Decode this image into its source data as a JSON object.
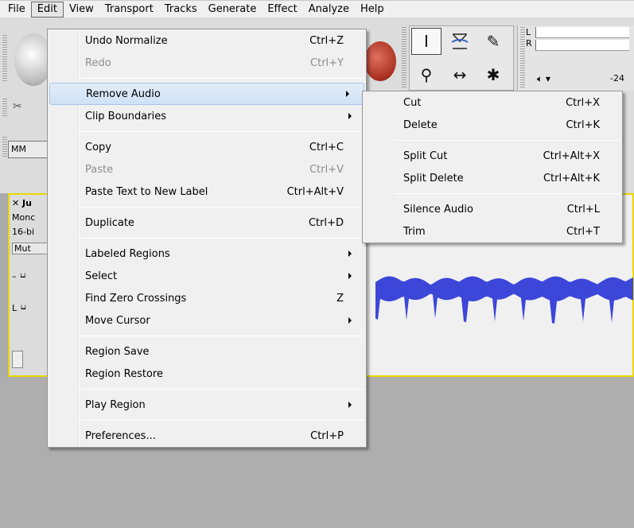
{
  "menubar": [
    "File",
    "Edit",
    "View",
    "Transport",
    "Tracks",
    "Generate",
    "Effect",
    "Analyze",
    "Help"
  ],
  "background": {
    "mm_label": "MM",
    "track_close": "✕ Ju",
    "track_channel": "Monc",
    "track_format": "16-bi",
    "track_mute": "Mut",
    "meter_l": "L",
    "meter_r": "R",
    "meter_db": "-24"
  },
  "edit_menu": {
    "groups": [
      [
        {
          "label": "Undo Normalize",
          "shortcut": "Ctrl+Z"
        },
        {
          "label": "Redo",
          "shortcut": "Ctrl+Y",
          "disabled": true
        }
      ],
      [
        {
          "label": "Remove Audio",
          "submenu": true,
          "highlighted": true
        },
        {
          "label": "Clip Boundaries",
          "submenu": true
        }
      ],
      [
        {
          "label": "Copy",
          "shortcut": "Ctrl+C"
        },
        {
          "label": "Paste",
          "shortcut": "Ctrl+V",
          "disabled": true
        },
        {
          "label": "Paste Text to New Label",
          "shortcut": "Ctrl+Alt+V"
        }
      ],
      [
        {
          "label": "Duplicate",
          "shortcut": "Ctrl+D"
        }
      ],
      [
        {
          "label": "Labeled Regions",
          "submenu": true
        },
        {
          "label": "Select",
          "submenu": true
        },
        {
          "label": "Find Zero Crossings",
          "shortcut": "Z"
        },
        {
          "label": "Move Cursor",
          "submenu": true
        }
      ],
      [
        {
          "label": "Region Save"
        },
        {
          "label": "Region Restore"
        }
      ],
      [
        {
          "label": "Play Region",
          "submenu": true
        }
      ],
      [
        {
          "label": "Preferences...",
          "shortcut": "Ctrl+P"
        }
      ]
    ]
  },
  "remove_audio_menu": {
    "groups": [
      [
        {
          "label": "Cut",
          "shortcut": "Ctrl+X"
        },
        {
          "label": "Delete",
          "shortcut": "Ctrl+K"
        }
      ],
      [
        {
          "label": "Split Cut",
          "shortcut": "Ctrl+Alt+X"
        },
        {
          "label": "Split Delete",
          "shortcut": "Ctrl+Alt+K"
        }
      ],
      [
        {
          "label": "Silence Audio",
          "shortcut": "Ctrl+L"
        },
        {
          "label": "Trim",
          "shortcut": "Ctrl+T"
        }
      ]
    ]
  },
  "colors": {
    "waveform": "#3c46d8",
    "track_border": "#e8d800",
    "highlight": "#cfe1f6"
  }
}
